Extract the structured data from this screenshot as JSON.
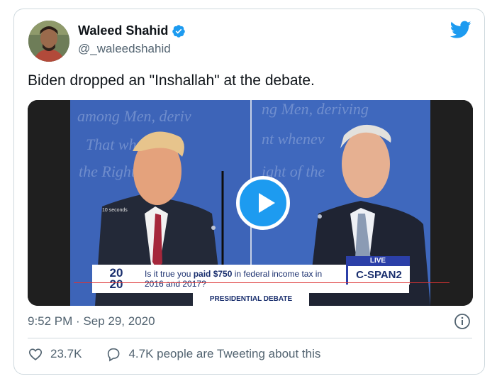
{
  "author": {
    "display_name": "Waleed Shahid",
    "handle": "@_waleedshahid",
    "verified": true
  },
  "tweet": {
    "text": "Biden dropped an \"Inshallah\" at the debate.",
    "timestamp": "9:52 PM · Sep 29, 2020"
  },
  "media": {
    "skip_label": "10 seconds",
    "chyron_logo_top": "20",
    "chyron_logo_bottom": "20",
    "question_line1_prefix": "Is it true you ",
    "question_line1_bold": "paid $750",
    "question_line1_suffix": " in federal income tax in",
    "question_line2": "2016 and 2017?",
    "live_label": "LIVE",
    "network": "C-SPAN2",
    "program": "PRESIDENTIAL DEBATE",
    "background_words": [
      "among Men, deriving",
      "That whenever",
      "the Right of",
      "Right of the People"
    ]
  },
  "engagement": {
    "likes": "23.7K",
    "tweeting_label": "4.7K people are Tweeting about this"
  },
  "colors": {
    "accent": "#1d9bf0",
    "secondary_text": "#536471",
    "border": "#cfd9de",
    "cspan_blue": "#1a2f6e"
  },
  "icons": [
    "verified-badge-icon",
    "twitter-bird-icon",
    "play-icon",
    "info-icon",
    "heart-icon",
    "reply-bubble-icon"
  ]
}
